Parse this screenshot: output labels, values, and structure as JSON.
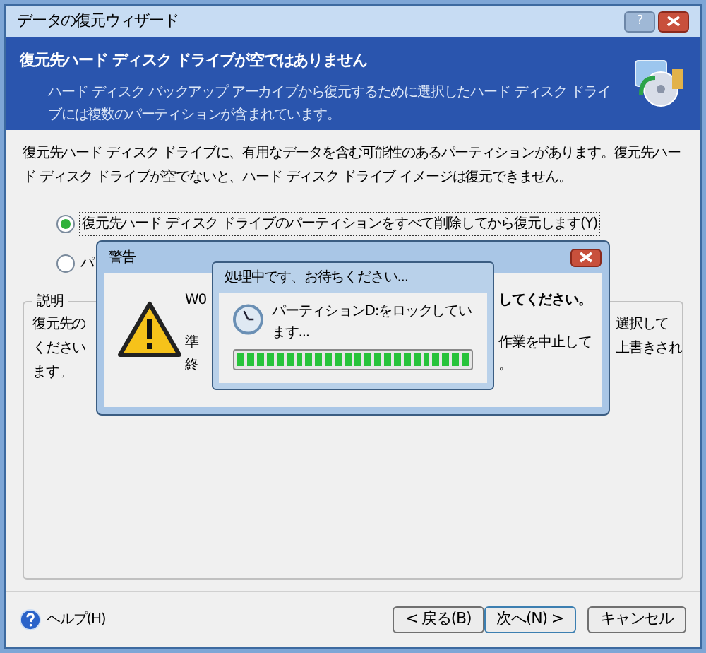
{
  "window": {
    "title": "データの復元ウィザード",
    "help_button": "?"
  },
  "header": {
    "title": "復元先ハード ディスク ドライブが空ではありません",
    "subtitle": "ハード ディスク バックアップ アーカイブから復元するために選択したハード ディスク ドライブには複数のパーティションが含まれています。"
  },
  "body_text": "復元先ハード ディスク ドライブに、有用なデータを含む可能性のあるパーティションがあります。復元先ハード ディスク ドライブが空でないと、ハード ディスク ドライブ イメージは復元できません。",
  "options": [
    {
      "label": "復元先ハード ディスク ドライブのパーティションをすべて削除してから復元します(Y)",
      "selected": true
    },
    {
      "label": "パ",
      "selected": false
    }
  ],
  "description_group": {
    "title": "説明",
    "left_lines": [
      "復元先の",
      "ください",
      "ます。"
    ],
    "right_lines": [
      "選択して",
      "上書きされ"
    ]
  },
  "warning_dialog": {
    "title": "警告",
    "lines": [
      {
        "left": "W0",
        "right": "してください。",
        "bold": true
      },
      {
        "left": "準",
        "right": "作業を中止して",
        "bold": false
      },
      {
        "left": "終",
        "right": "。",
        "bold": false
      }
    ]
  },
  "progress_dialog": {
    "title": "処理中です、お待ちください...",
    "message": "パーティションD:をロックしています...",
    "level": 1
  },
  "footer": {
    "help": "ヘルプ(H)",
    "buttons": [
      {
        "label": "< 戻る(B)",
        "default": false
      },
      {
        "label": "次へ(N) >",
        "default": true
      },
      {
        "label": "キャンセル",
        "default": false
      }
    ]
  }
}
